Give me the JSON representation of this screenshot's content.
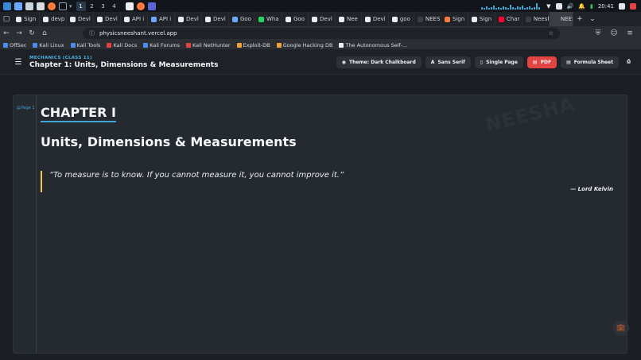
{
  "os_bar": {
    "workspaces": [
      "1",
      "2",
      "3",
      "4"
    ],
    "active_workspace": "1",
    "clock": "20:41"
  },
  "tabs": [
    {
      "label": "Sign",
      "fav": "#e8eef4"
    },
    {
      "label": "devp",
      "fav": "#e8eef4"
    },
    {
      "label": "Devl",
      "fav": "#e8eef4"
    },
    {
      "label": "Devl",
      "fav": "#e8eef4"
    },
    {
      "label": "API i",
      "fav": "#e8eef4"
    },
    {
      "label": "API i",
      "fav": "#6aa9ff"
    },
    {
      "label": "Devl",
      "fav": "#e8eef4"
    },
    {
      "label": "Devl",
      "fav": "#e8eef4"
    },
    {
      "label": "Goo",
      "fav": "#6aa9ff"
    },
    {
      "label": "Wha",
      "fav": "#25d366"
    },
    {
      "label": "Goo",
      "fav": "#e8eef4"
    },
    {
      "label": "Devl",
      "fav": "#e8eef4"
    },
    {
      "label": "Nee",
      "fav": "#e8eef4"
    },
    {
      "label": "Devl",
      "fav": "#e8eef4"
    },
    {
      "label": "goo",
      "fav": "#e8eef4"
    },
    {
      "label": "NEESH",
      "fav": "#3a3e43"
    },
    {
      "label": "Sign",
      "fav": "#ff7a3d"
    },
    {
      "label": "Sign",
      "fav": "#e8eef4"
    },
    {
      "label": "Char",
      "fav": "#ff0033"
    },
    {
      "label": "Neesha",
      "fav": "#3a3e43"
    },
    {
      "label": "NEES",
      "fav": "#3a3e43",
      "active": true
    }
  ],
  "address_bar": {
    "url": "physicsneeshant.vercel.app"
  },
  "bookmarks": [
    {
      "label": "OffSec",
      "fav": "#4a8df0"
    },
    {
      "label": "Kali Linux",
      "fav": "#4a8df0"
    },
    {
      "label": "Kali Tools",
      "fav": "#4a8df0"
    },
    {
      "label": "Kali Docs",
      "fav": "#e24444"
    },
    {
      "label": "Kali Forums",
      "fav": "#4a8df0"
    },
    {
      "label": "Kali NetHunter",
      "fav": "#e24444"
    },
    {
      "label": "Exploit-DB",
      "fav": "#f0a23a"
    },
    {
      "label": "Google Hacking DB",
      "fav": "#f0a23a"
    },
    {
      "label": "The Autonomous Self-...",
      "fav": "#e8eef4"
    }
  ],
  "header": {
    "subject": "MECHANICS (CLASS 11)",
    "title": "Chapter 1: Units, Dimensions & Measurements",
    "theme_label": "Theme: Dark Chalkboard",
    "font_label": "Sans Serif",
    "view_label": "Single Page",
    "pdf_label": "PDF",
    "formula_label": "Formula Sheet"
  },
  "content": {
    "page_tag": "Page 1",
    "watermark": "NEESHA",
    "chapter_label": "CHAPTER I",
    "heading": "Units, Dimensions & Measurements",
    "quote": "“To measure is to know. If you cannot measure it, you cannot improve it.”",
    "quote_author": "— Lord Kelvin"
  },
  "colors": {
    "accent": "#3fa6d8",
    "pdf": "#e24444",
    "quote_bar": "#f2c94c"
  }
}
